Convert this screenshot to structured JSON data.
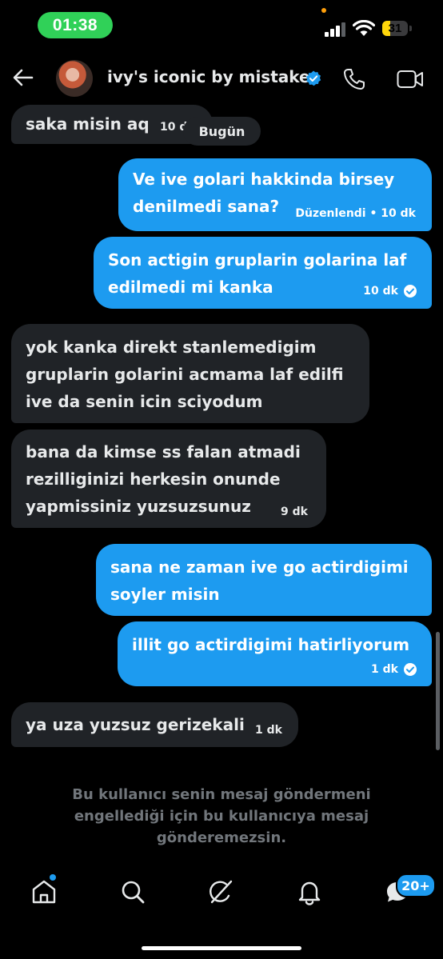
{
  "status_bar": {
    "time": "01:38",
    "battery_level": "31",
    "battery_fraction": 0.31,
    "accent_colors": {
      "time_pill": "#30d158",
      "battery": "#ffd60a",
      "privacy_dot": "#ff9f0a"
    }
  },
  "header": {
    "back_icon": "arrow-left-icon",
    "title": "ivy's iconic by mistake",
    "verified_icon": "verified-badge-icon",
    "call_icon": "phone-icon",
    "video_icon": "video-camera-icon"
  },
  "conversation": {
    "day_divider": "Bugün",
    "messages": [
      {
        "direction": "received",
        "lines": [
          "saka misin aq"
        ],
        "time": "10 d"
      },
      {
        "direction": "sent",
        "lines": [
          "Ve ive golari hakkinda birsey",
          "denilmedi sana?"
        ],
        "time": "Düzenlendi • 10 dk"
      },
      {
        "direction": "sent",
        "lines": [
          "Son actigin gruplarin golarina laf",
          "edilmedi mi kanka"
        ],
        "time": "10 dk",
        "read": true
      },
      {
        "direction": "received",
        "lines": [
          "yok kanka direkt stanlemedigim",
          "gruplarin golarini acmama laf edilfi",
          "ive da senin icin sciyodum"
        ]
      },
      {
        "direction": "received",
        "lines": [
          "bana da kimse ss falan atmadi",
          "rezilliginizi herkesin onunde",
          "yapmissiniz yuzsuzsunuz"
        ],
        "time": "9 dk"
      },
      {
        "direction": "sent",
        "lines": [
          "sana ne zaman ive go actirdigimi",
          "soyler misin"
        ]
      },
      {
        "direction": "sent",
        "lines": [
          "illit go actirdigimi hatirliyorum"
        ],
        "time": "1 dk",
        "read": true
      },
      {
        "direction": "received",
        "lines": [
          "ya uza yuzsuz gerizekali"
        ],
        "time": "1 dk"
      }
    ]
  },
  "blocked_notice": [
    "Bu kullanıcı senin mesaj göndermeni",
    "engellediği için bu kullanıcıya mesaj",
    "gönderemezsin."
  ],
  "bottom_nav": {
    "items": [
      "home-icon",
      "search-icon",
      "grok-icon",
      "notifications-icon",
      "messages-icon"
    ],
    "messages_badge": "20+"
  },
  "colors": {
    "sent_bubble": "#1d9bf0",
    "received_bubble": "#202327",
    "background": "#000000"
  }
}
